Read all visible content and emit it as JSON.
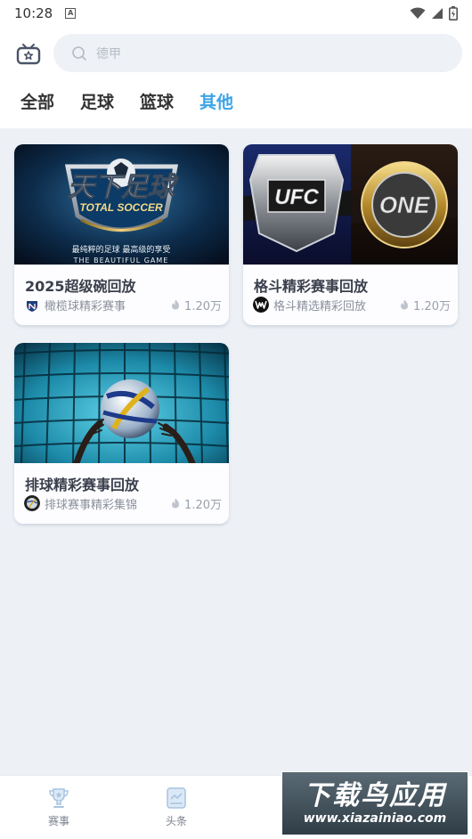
{
  "status_bar": {
    "time": "10:28",
    "notification_icon": "A"
  },
  "search": {
    "placeholder": "德甲"
  },
  "tabs": [
    {
      "label": "全部",
      "active": false
    },
    {
      "label": "足球",
      "active": false
    },
    {
      "label": "篮球",
      "active": false
    },
    {
      "label": "其他",
      "active": true
    }
  ],
  "cards": [
    {
      "title": "2025超级碗回放",
      "source": "橄榄球精彩赛事",
      "views": "1.20万",
      "thumb": {
        "logo_main": "天下足球",
        "logo_sub": "TOTAL SOCCER",
        "caption": "最纯粹的足球 最高级的享受",
        "caption_en": "THE BEAUTIFUL GAME"
      },
      "avatar_icon": "nfl-shield-icon"
    },
    {
      "title": "格斗精彩赛事回放",
      "source": "格斗精选精彩回放",
      "views": "1.20万",
      "thumb": {
        "left_belt": "UFC",
        "right_belt": "ONE"
      },
      "avatar_icon": "wwe-logo-icon"
    },
    {
      "title": "排球精彩赛事回放",
      "source": "排球赛事精彩集锦",
      "views": "1.20万",
      "thumb": {},
      "avatar_icon": "volleyball-avatar-icon"
    }
  ],
  "bottom_nav": [
    {
      "label": "赛事",
      "icon": "trophy-icon"
    },
    {
      "label": "头条",
      "icon": "news-icon"
    }
  ],
  "watermark": {
    "big": "下载鸟应用",
    "small": "www.xiazainiao.com"
  },
  "colors": {
    "accent": "#3ba3e6",
    "background": "#edf1f6"
  }
}
